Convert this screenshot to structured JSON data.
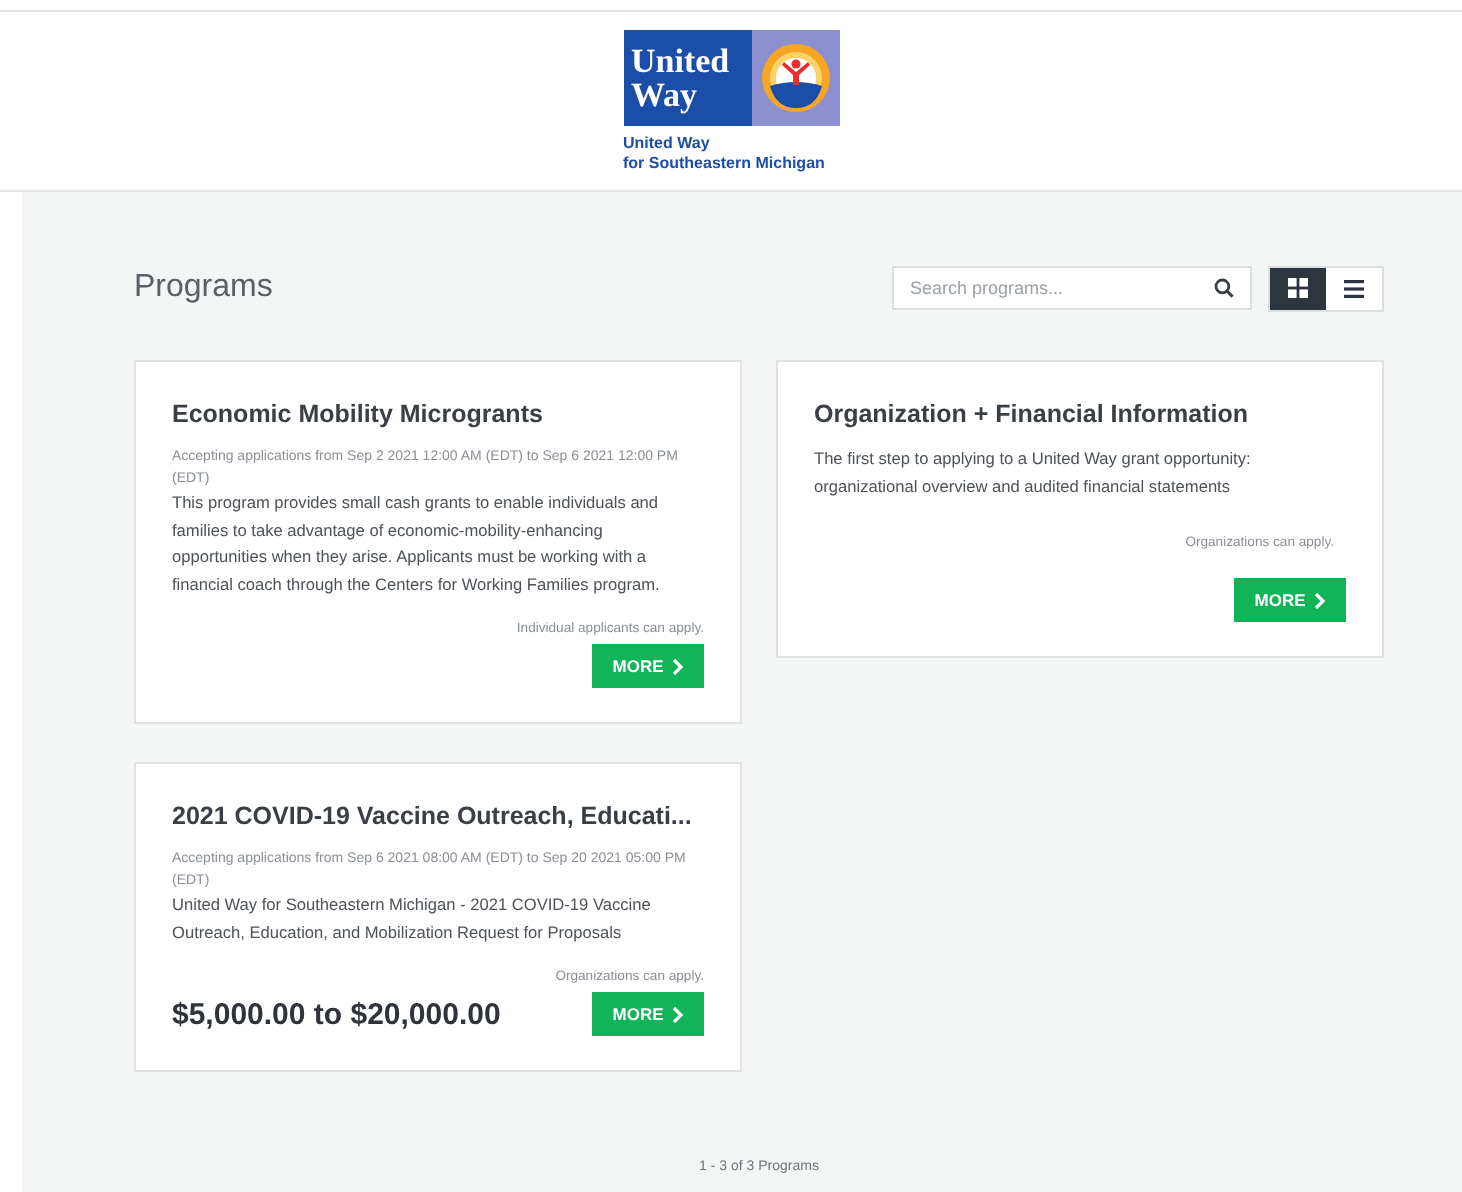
{
  "logo": {
    "wordmark_line_1": "United",
    "wordmark_line_2": "Way",
    "subtitle_line_1": "United Way",
    "subtitle_line_2": "for Southeastern Michigan"
  },
  "page_title": "Programs",
  "search": {
    "placeholder": "Search programs..."
  },
  "view_options": [
    {
      "kind": "grid",
      "selected": true
    },
    {
      "kind": "list",
      "selected": false
    }
  ],
  "programs": [
    {
      "title": "Economic Mobility Microgrants",
      "dates": "Accepting applications from Sep 2 2021 12:00 AM (EDT) to Sep 6 2021 12:00 PM (EDT)",
      "description": "This program provides small cash grants to enable individuals and families to take advantage of economic-mobility-enhancing opportunities when they arise. Applicants must be working with a financial coach through the Centers for Working Families program.",
      "eligibility": "Individual applicants can apply.",
      "button": "MORE"
    },
    {
      "title": "Organization + Financial Information",
      "description": "The first step to applying to a United Way grant opportunity: organizational overview and audited financial statements",
      "eligibility": "Organizations can apply.",
      "button": "MORE"
    },
    {
      "title": "2021 COVID-19 Vaccine Outreach, Educati...",
      "dates": "Accepting applications from Sep 6 2021 08:00 AM (EDT) to Sep 20 2021 05:00 PM (EDT)",
      "description": "United Way for Southeastern Michigan - 2021 COVID-19 Vaccine Outreach, Education, and Mobilization Request for Proposals",
      "eligibility": "Organizations can apply.",
      "amount": "$5,000.00 to $20,000.00",
      "button": "MORE"
    }
  ],
  "pagination": "1 - 3 of 3 Programs"
}
